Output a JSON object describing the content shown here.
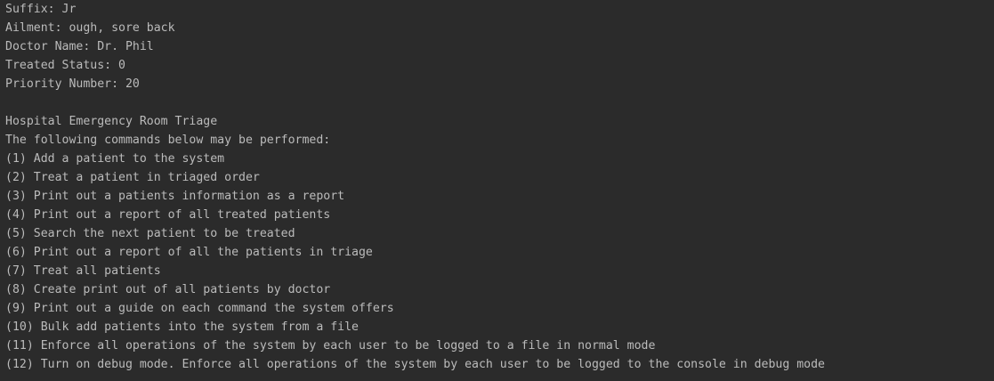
{
  "console": {
    "colors": {
      "background": "#2b2b2b",
      "text": "#bbbbbb"
    },
    "lines": [
      "Suffix: Jr",
      "Ailment: ough, sore back",
      "Doctor Name: Dr. Phil",
      "Treated Status: 0",
      "Priority Number: 20",
      "",
      "Hospital Emergency Room Triage",
      "The following commands below may be performed:",
      "(1) Add a patient to the system",
      "(2) Treat a patient in triaged order",
      "(3) Print out a patients information as a report",
      "(4) Print out a report of all treated patients",
      "(5) Search the next patient to be treated",
      "(6) Print out a report of all the patients in triage",
      "(7) Treat all patients",
      "(8) Create print out of all patients by doctor",
      "(9) Print out a guide on each command the system offers",
      "(10) Bulk add patients into the system from a file",
      "(11) Enforce all operations of the system by each user to be logged to a file in normal mode",
      "(12) Turn on debug mode. Enforce all operations of the system by each user to be logged to the console in debug mode"
    ]
  }
}
